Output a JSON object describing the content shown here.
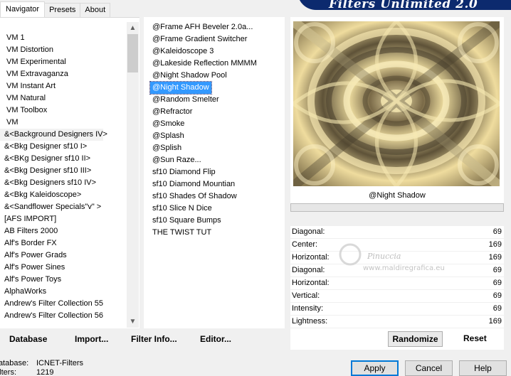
{
  "tabs": [
    "Navigator",
    "Presets",
    "About"
  ],
  "banner_title": "Filters Unlimited 2.0",
  "categories": [
    "VM 1",
    "VM Distortion",
    "VM Experimental",
    "VM Extravaganza",
    "VM Instant Art",
    "VM Natural",
    "VM Toolbox",
    "VM",
    "&<Background Designers IV>",
    "&<Bkg Designer sf10 I>",
    "&<BKg Designer sf10 II>",
    "&<Bkg Designer sf10 III>",
    "&<Bkg Designers sf10 IV>",
    "&<Bkg Kaleidoscope>",
    "&<Sandflower Specials\"v\" >",
    "[AFS IMPORT]",
    "AB Filters 2000",
    "Alf's Border FX",
    "Alf's Power Grads",
    "Alf's Power Sines",
    "Alf's Power Toys",
    "AlphaWorks",
    "Andrew's Filter Collection 55",
    "Andrew's Filter Collection 56"
  ],
  "filters": [
    "@Frame AFH Beveler 2.0a...",
    "@Frame Gradient Switcher",
    "@Kaleidoscope 3",
    "@Lakeside Reflection MMMM",
    "@Night Shadow Pool",
    "@Night Shadow",
    "@Random Smelter",
    "@Refractor",
    "@Smoke",
    "@Splash",
    "@Splish",
    "@Sun Raze...",
    "sf10 Diamond Flip",
    "sf10 Diamond Mountian",
    "sf10 Shades Of Shadow",
    "sf10 Slice N Dice",
    "sf10 Square Bumps",
    "THE TWIST TUT"
  ],
  "selected_filter": "@Night Shadow",
  "sliders": [
    {
      "label": "Diagonal:",
      "value": "69"
    },
    {
      "label": "Center:",
      "value": "169"
    },
    {
      "label": "Horizontal:",
      "value": "169"
    },
    {
      "label": "Diagonal:",
      "value": "69"
    },
    {
      "label": "Horizontal:",
      "value": "69"
    },
    {
      "label": "Vertical:",
      "value": "69"
    },
    {
      "label": "Intensity:",
      "value": "69"
    },
    {
      "label": "Lightness:",
      "value": "169"
    }
  ],
  "toolbar": {
    "database": "Database",
    "import": "Import...",
    "filter_info": "Filter Info...",
    "editor": "Editor...",
    "randomize": "Randomize",
    "reset": "Reset"
  },
  "info": {
    "database_key": "Database:",
    "database_val": "ICNET-Filters",
    "filters_key": "Filters:",
    "filters_val": "1219"
  },
  "buttons": {
    "apply": "Apply",
    "cancel": "Cancel",
    "help": "Help"
  },
  "watermark": {
    "name": "Pinuccia",
    "site": "www.maldiregrafica.eu"
  },
  "colors": {
    "selection": "#3399ff",
    "banner": "#0c2a6e",
    "preview_base": "#d9c48a"
  }
}
